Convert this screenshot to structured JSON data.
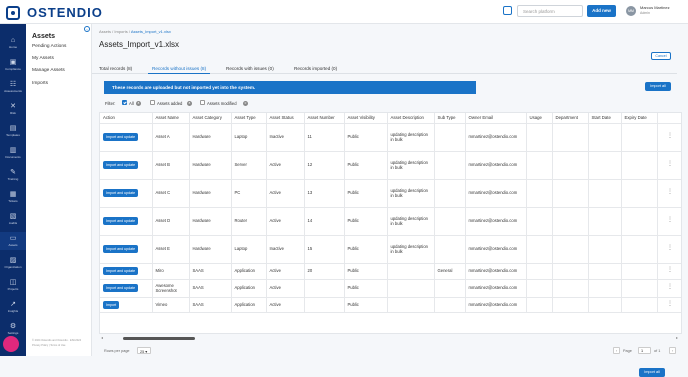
{
  "topbar": {
    "brand": "OSTENDIO",
    "search_placeholder": "Search platform",
    "add_new": "Add new",
    "user_initials": "MM",
    "user_name": "Marcus Martinez",
    "user_role": "Admin"
  },
  "rail": [
    {
      "glyph": "⌂",
      "label": "Home",
      "icon": "home-icon"
    },
    {
      "glyph": "▣",
      "label": "Compliance",
      "icon": "compliance-icon"
    },
    {
      "glyph": "☷",
      "label": "Assessments",
      "icon": "assessments-icon"
    },
    {
      "glyph": "✕",
      "label": "Risk",
      "icon": "risk-icon"
    },
    {
      "glyph": "▤",
      "label": "Templates",
      "icon": "templates-icon"
    },
    {
      "glyph": "▥",
      "label": "Documents",
      "icon": "documents-icon"
    },
    {
      "glyph": "✎",
      "label": "Training",
      "icon": "training-icon"
    },
    {
      "glyph": "▦",
      "label": "Tickets",
      "icon": "tickets-icon"
    },
    {
      "glyph": "▧",
      "label": "Audits",
      "icon": "audits-icon"
    },
    {
      "glyph": "▭",
      "label": "Assets",
      "icon": "assets-icon"
    },
    {
      "glyph": "▨",
      "label": "Organization",
      "icon": "organization-icon"
    },
    {
      "glyph": "◫",
      "label": "Projects",
      "icon": "projects-icon"
    },
    {
      "glyph": "↗",
      "label": "Insights",
      "icon": "insights-icon"
    },
    {
      "glyph": "⚙",
      "label": "Settings",
      "icon": "settings-icon"
    }
  ],
  "sidebar": {
    "title": "Assets",
    "collapse_glyph": "‹",
    "items": [
      "Pending Actions",
      "My Assets",
      "Manage Assets",
      "Imports"
    ],
    "footer_line1": "© 2024 Ostendio and Ostendio · ESC2024",
    "footer_line2": "Privacy Policy | Terms of Use"
  },
  "main": {
    "breadcrumb": [
      "Assets",
      "Imports",
      "Assets_Import_v1.xlsx"
    ],
    "breadcrumb_sep": "/",
    "title": "Assets_Import_v1.xlsx",
    "cancel": "Cancel",
    "tabs": [
      "Total records (8)",
      "Records without issues (8)",
      "Records with issues (0)",
      "Records imported (0)"
    ],
    "banner": "These records are uploaded but not imported yet into the system.",
    "import_all": "Import all",
    "filter": {
      "label": "Filter:",
      "all": "All",
      "all_count": "8",
      "added": "Assets added",
      "added_count": "8",
      "modified": "Assets modified",
      "modified_count": "0"
    }
  },
  "table": {
    "columns": [
      "Action",
      "Asset Name",
      "Asset Category",
      "Asset Type",
      "Asset Status",
      "Asset Number",
      "Asset Visibility",
      "Asset Description",
      "Sub Type",
      "Owner Email",
      "Usage",
      "Department",
      "Start Date",
      "Expiry Date"
    ],
    "rows": [
      {
        "action": "Import and update",
        "name": "Asset A",
        "category": "Hardware",
        "type": "Laptop",
        "status": "Inactive",
        "number": "11",
        "visibility": "Public",
        "description": "updating description in bulk",
        "subtype": "",
        "email": "mmartinez@ostendio.com"
      },
      {
        "action": "Import and update",
        "name": "Asset B",
        "category": "Hardware",
        "type": "Server",
        "status": "Active",
        "number": "12",
        "visibility": "Public",
        "description": "updating description in bulk",
        "subtype": "",
        "email": "mmartinez@ostendio.com"
      },
      {
        "action": "Import and update",
        "name": "Asset C",
        "category": "Hardware",
        "type": "PC",
        "status": "Active",
        "number": "13",
        "visibility": "Public",
        "description": "updating description in bulk",
        "subtype": "",
        "email": "mmartinez@ostendio.com"
      },
      {
        "action": "Import and update",
        "name": "Asset D",
        "category": "Hardware",
        "type": "Router",
        "status": "Active",
        "number": "14",
        "visibility": "Public",
        "description": "updating description in bulk",
        "subtype": "",
        "email": "mmartinez@ostendio.com"
      },
      {
        "action": "Import and update",
        "name": "Asset E",
        "category": "Hardware",
        "type": "Laptop",
        "status": "Inactive",
        "number": "15",
        "visibility": "Public",
        "description": "updating description in bulk",
        "subtype": "",
        "email": "mmartinez@ostendio.com"
      },
      {
        "action": "Import and update",
        "name": "Miro",
        "category": "SAAS",
        "type": "Application",
        "status": "Active",
        "number": "20",
        "visibility": "Public",
        "description": "",
        "subtype": "General",
        "email": "mmartinez@ostendio.com"
      },
      {
        "action": "Import and update",
        "name": "Awesome Screenshot",
        "category": "SAAS",
        "type": "Application",
        "status": "Active",
        "number": "",
        "visibility": "Public",
        "description": "",
        "subtype": "",
        "email": "mmartinez@ostendio.com"
      },
      {
        "action": "Import",
        "name": "Vimeo",
        "category": "SAAS",
        "type": "Application",
        "status": "Active",
        "number": "",
        "visibility": "Public",
        "description": "",
        "subtype": "",
        "email": "mmartinez@ostendio.com"
      }
    ]
  },
  "pagination": {
    "rows_per_page_label": "Rows per page",
    "rows_per_page": "25",
    "page_label": "Page",
    "page": "1",
    "of_label": "of 1"
  },
  "colors": {
    "accent": "#1a73c7",
    "rail": "#0c2d6b",
    "bubble": "#e0287d"
  }
}
